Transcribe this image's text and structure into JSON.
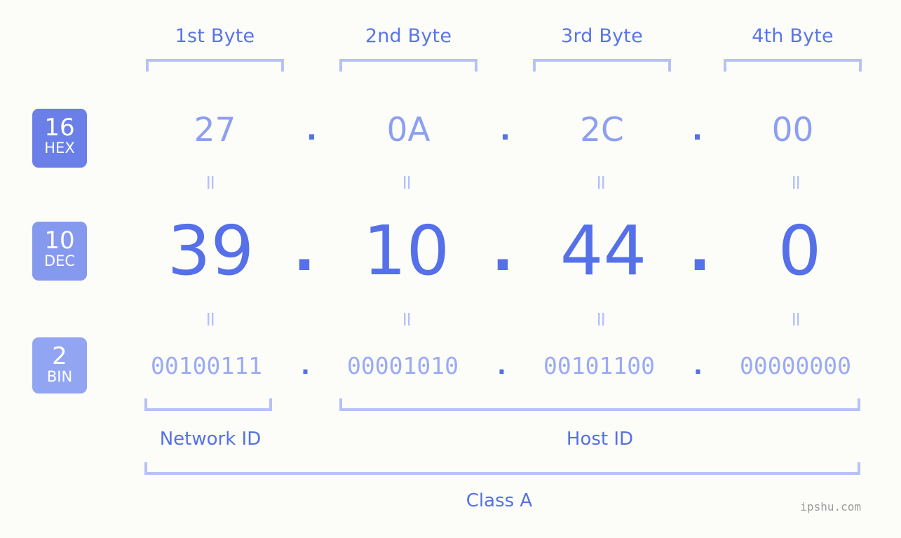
{
  "colors": {
    "background": "#fcfdf9",
    "accent_strong": "#5570e8",
    "accent_mid": "#8d9ff0",
    "accent_light": "#b6c1fb",
    "badge_hex": "#6b7fe8",
    "badge_dec": "#8599ee",
    "badge_bin": "#92a5f2",
    "watermark": "#9a9a9a"
  },
  "byte_headers": [
    {
      "label": "1st Byte"
    },
    {
      "label": "2nd Byte"
    },
    {
      "label": "3rd Byte"
    },
    {
      "label": "4th Byte"
    }
  ],
  "bases": {
    "hex": {
      "number": "16",
      "abbr": "HEX"
    },
    "dec": {
      "number": "10",
      "abbr": "DEC"
    },
    "bin": {
      "number": "2",
      "abbr": "BIN"
    }
  },
  "rows": {
    "hex": {
      "values": [
        "27",
        "0A",
        "2C",
        "00"
      ],
      "separator": "."
    },
    "dec": {
      "values": [
        "39",
        "10",
        "44",
        "0"
      ],
      "separator": "."
    },
    "bin": {
      "values": [
        "00100111",
        "00001010",
        "00101100",
        "00000000"
      ],
      "separator": "."
    }
  },
  "equals_symbol": "=",
  "sections": {
    "network_id": "Network ID",
    "host_id": "Host ID",
    "class": "Class A"
  },
  "watermark": "ipshu.com"
}
